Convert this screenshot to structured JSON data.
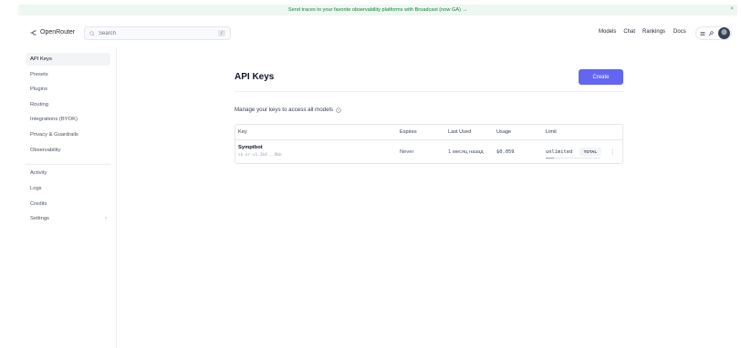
{
  "banner": {
    "text": "Send traces to your favorite observability platforms with Broadcast (now GA) →",
    "close": "×"
  },
  "header": {
    "logo_text": "OpenRouter",
    "search_placeholder": "Search",
    "search_shortcut": "/",
    "nav": [
      "Models",
      "Chat",
      "Rankings",
      "Docs"
    ]
  },
  "sidebar": {
    "items": [
      {
        "label": "API Keys",
        "active": true
      },
      {
        "label": "Presets"
      },
      {
        "label": "Plugins"
      },
      {
        "label": "Routing"
      },
      {
        "label": "Integrations (BYOK)"
      },
      {
        "label": "Privacy & Guardrails"
      },
      {
        "label": "Observability"
      },
      {
        "label": "Activity"
      },
      {
        "label": "Logs"
      },
      {
        "label": "Credits"
      },
      {
        "label": "Settings"
      }
    ],
    "settings_chevron": "›"
  },
  "main": {
    "title": "API Keys",
    "create_label": "Create",
    "subtitle": "Manage your keys to access all models",
    "table": {
      "headers": [
        "Key",
        "Expires",
        "Last Used",
        "Usage",
        "Limit"
      ],
      "rows": [
        {
          "name": "Symptbot",
          "key_id": "sk-or-v1-2b4...9bb",
          "expires": "Never",
          "last_used": "1 месяц назад",
          "usage": "$0.059",
          "limit": "unlimited",
          "limit_type": "TOTAL",
          "limit_used_fraction": 0.15,
          "menu": "⋮"
        }
      ]
    }
  },
  "colors": {
    "accent": "#6366f1",
    "banner_bg": "#eef7f1",
    "banner_text": "#15803d"
  },
  "icons": [
    "logo-icon",
    "search-icon",
    "menu-icon",
    "key-icon",
    "info-icon",
    "chevron-right-icon",
    "more-vertical-icon"
  ]
}
